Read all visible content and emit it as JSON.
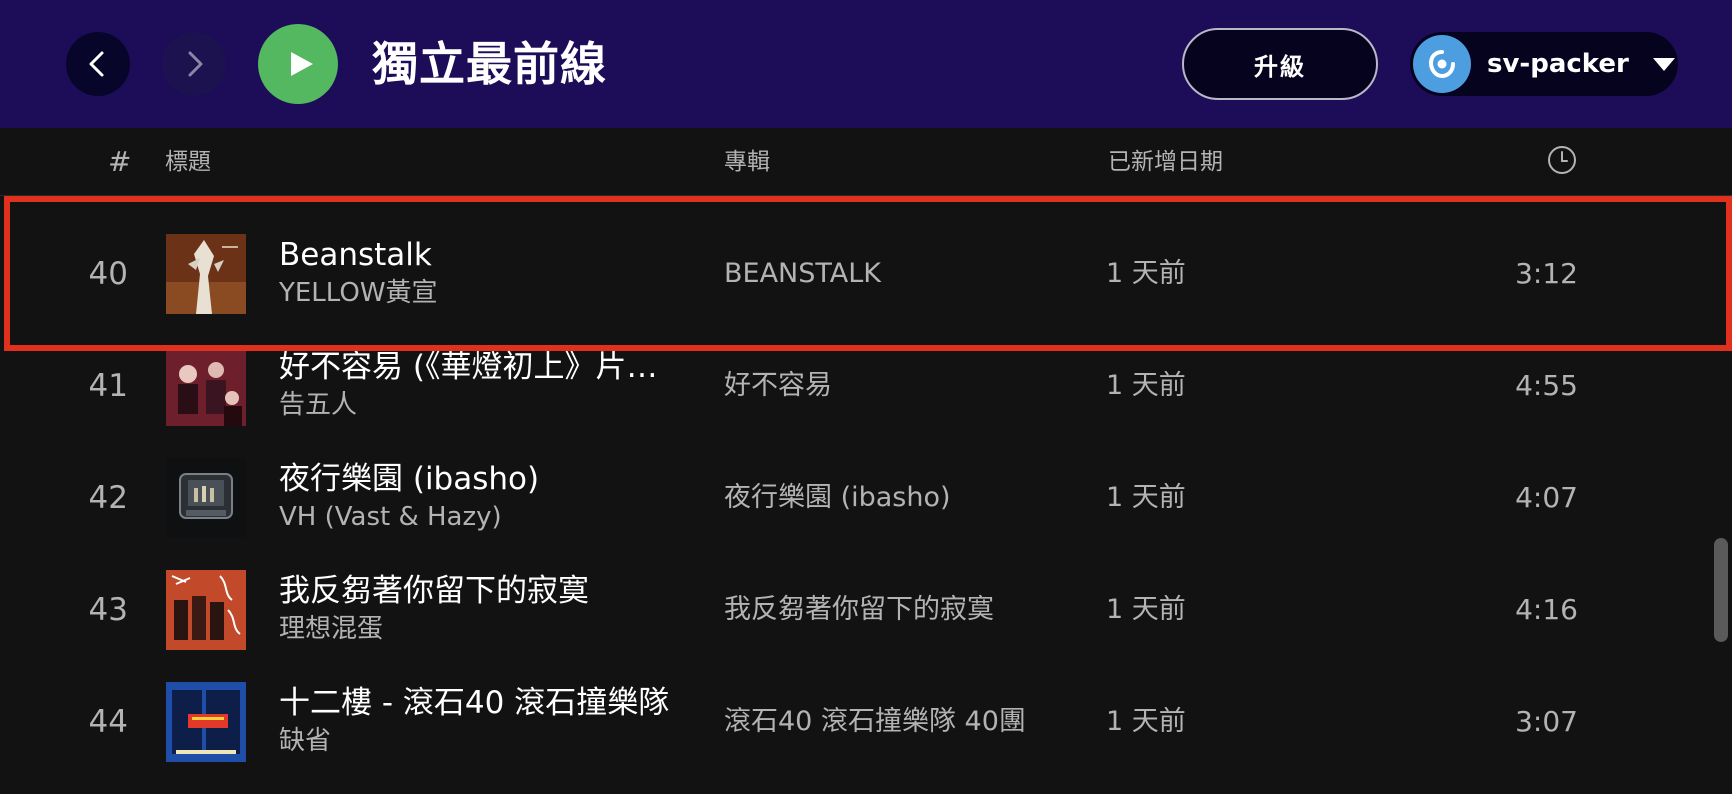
{
  "header": {
    "playlist_title": "獨立最前線",
    "upgrade_label": "升級",
    "username": "sv-packer"
  },
  "table": {
    "columns": {
      "number": "#",
      "title": "標題",
      "album": "專輯",
      "date_added": "已新增日期"
    },
    "rows": [
      {
        "num": "40",
        "title": "Beanstalk",
        "artist": "YELLOW黃宣",
        "album": "BEANSTALK",
        "date": "1 天前",
        "duration": "3:12"
      },
      {
        "num": "41",
        "title": "好不容易 (《華燈初上》片尾曲)",
        "artist": "告五人",
        "album": "好不容易",
        "date": "1 天前",
        "duration": "4:55"
      },
      {
        "num": "42",
        "title": "夜行樂園 (ibasho)",
        "artist": "VH (Vast & Hazy)",
        "album": "夜行樂園 (ibasho)",
        "date": "1 天前",
        "duration": "4:07"
      },
      {
        "num": "43",
        "title": "我反芻著你留下的寂寞",
        "artist": "理想混蛋",
        "album": "我反芻著你留下的寂寞",
        "date": "1 天前",
        "duration": "4:16"
      },
      {
        "num": "44",
        "title": "十二樓 - 滾石40 滾石撞樂隊",
        "artist": "缺省",
        "album": "滾石40 滾石撞樂隊 40團",
        "date": "1 天前",
        "duration": "3:07"
      }
    ]
  },
  "colors": {
    "topbar_bg": "#1d0c58",
    "play_green": "#53b860",
    "highlight_red": "#e0301e",
    "body_bg": "#121212"
  },
  "icons": {
    "back": "chevron-left-icon",
    "forward": "chevron-right-icon",
    "play": "play-icon",
    "avatar": "user-avatar-icon",
    "caret": "caret-down-icon",
    "duration": "clock-icon"
  }
}
